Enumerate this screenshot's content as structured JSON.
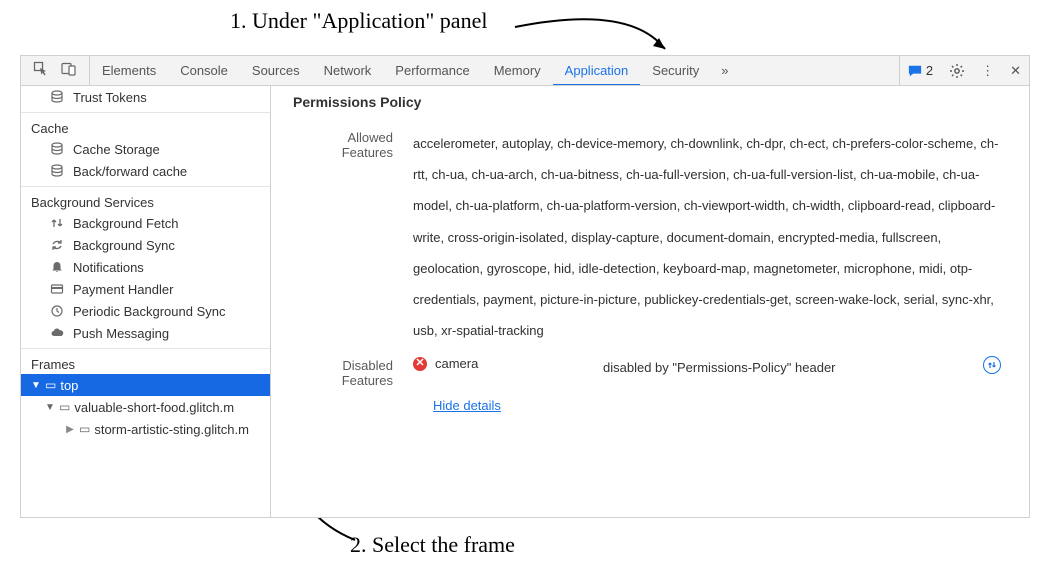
{
  "annotations": {
    "step1": "1. Under \"Application\" panel",
    "step2": "2. Select the frame"
  },
  "toolbar": {
    "tabs": [
      "Elements",
      "Console",
      "Sources",
      "Network",
      "Performance",
      "Memory",
      "Application",
      "Security"
    ],
    "active_tab": "Application",
    "message_count": "2"
  },
  "sidebar": {
    "trust_tokens": "Trust Tokens",
    "cache_header": "Cache",
    "cache": [
      "Cache Storage",
      "Back/forward cache"
    ],
    "bg_header": "Background Services",
    "bg": [
      "Background Fetch",
      "Background Sync",
      "Notifications",
      "Payment Handler",
      "Periodic Background Sync",
      "Push Messaging"
    ],
    "frames_header": "Frames",
    "tree": {
      "top": "top",
      "child1": "valuable-short-food.glitch.m",
      "child2": "storm-artistic-sting.glitch.m"
    }
  },
  "main": {
    "title": "Permissions Policy",
    "allowed_label": "Allowed Features",
    "allowed_text": "accelerometer, autoplay, ch-device-memory, ch-downlink, ch-dpr, ch-ect, ch-prefers-color-scheme, ch-rtt, ch-ua, ch-ua-arch, ch-ua-bitness, ch-ua-full-version, ch-ua-full-version-list, ch-ua-mobile, ch-ua-model, ch-ua-platform, ch-ua-platform-version, ch-viewport-width, ch-width, clipboard-read, clipboard-write, cross-origin-isolated, display-capture, document-domain, encrypted-media, fullscreen, geolocation, gyroscope, hid, idle-detection, keyboard-map, magnetometer, microphone, midi, otp-credentials, payment, picture-in-picture, publickey-credentials-get, screen-wake-lock, serial, sync-xhr, usb, xr-spatial-tracking",
    "disabled_label": "Disabled Features",
    "disabled_feature": "camera",
    "disabled_reason": "disabled by \"Permissions-Policy\" header",
    "hide_details": "Hide details"
  }
}
